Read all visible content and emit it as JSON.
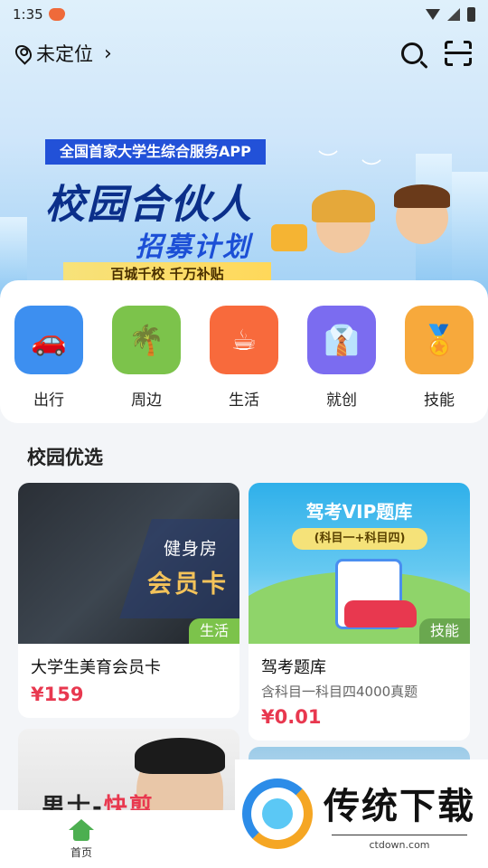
{
  "status_bar": {
    "time": "1:35"
  },
  "topbar": {
    "location": "未定位",
    "chevron": "›"
  },
  "banner": {
    "tag": "全国首家大学生综合服务APP",
    "title": "校园合伙人",
    "subtitle": "招募计划",
    "strip": "百城千校  千万补贴"
  },
  "categories": [
    {
      "label": "出行",
      "icon": "car-icon",
      "color": "#3d8ff0",
      "glyph": "🚗"
    },
    {
      "label": "周边",
      "icon": "palm-tree-icon",
      "color": "#7cc34b",
      "glyph": "🌴"
    },
    {
      "label": "生活",
      "icon": "coffee-cup-icon",
      "color": "#f86a3c",
      "glyph": "☕"
    },
    {
      "label": "就创",
      "icon": "tie-icon",
      "color": "#7b6cf0",
      "glyph": "👔"
    },
    {
      "label": "技能",
      "icon": "badge-icon",
      "color": "#f7a93c",
      "glyph": "🏅"
    }
  ],
  "section": {
    "title": "校园优选"
  },
  "products": [
    {
      "title": "大学生美育会员卡",
      "price": "¥159",
      "tag": "生活",
      "image_text_1": "健身房",
      "image_text_2": "会员卡"
    },
    {
      "title": "驾考题库",
      "desc": "含科目一科目四4000真题",
      "price": "¥0.01",
      "tag": "技能",
      "image_title": "驾考VIP题库",
      "image_sub": "(科目一+科目四)"
    }
  ],
  "card3": {
    "text_plain": "男士-",
    "text_highlight": "快剪"
  },
  "bottom_nav": {
    "home_label": "首页"
  },
  "watermark": {
    "brand": "传统下载",
    "url": "ctdown.com"
  }
}
